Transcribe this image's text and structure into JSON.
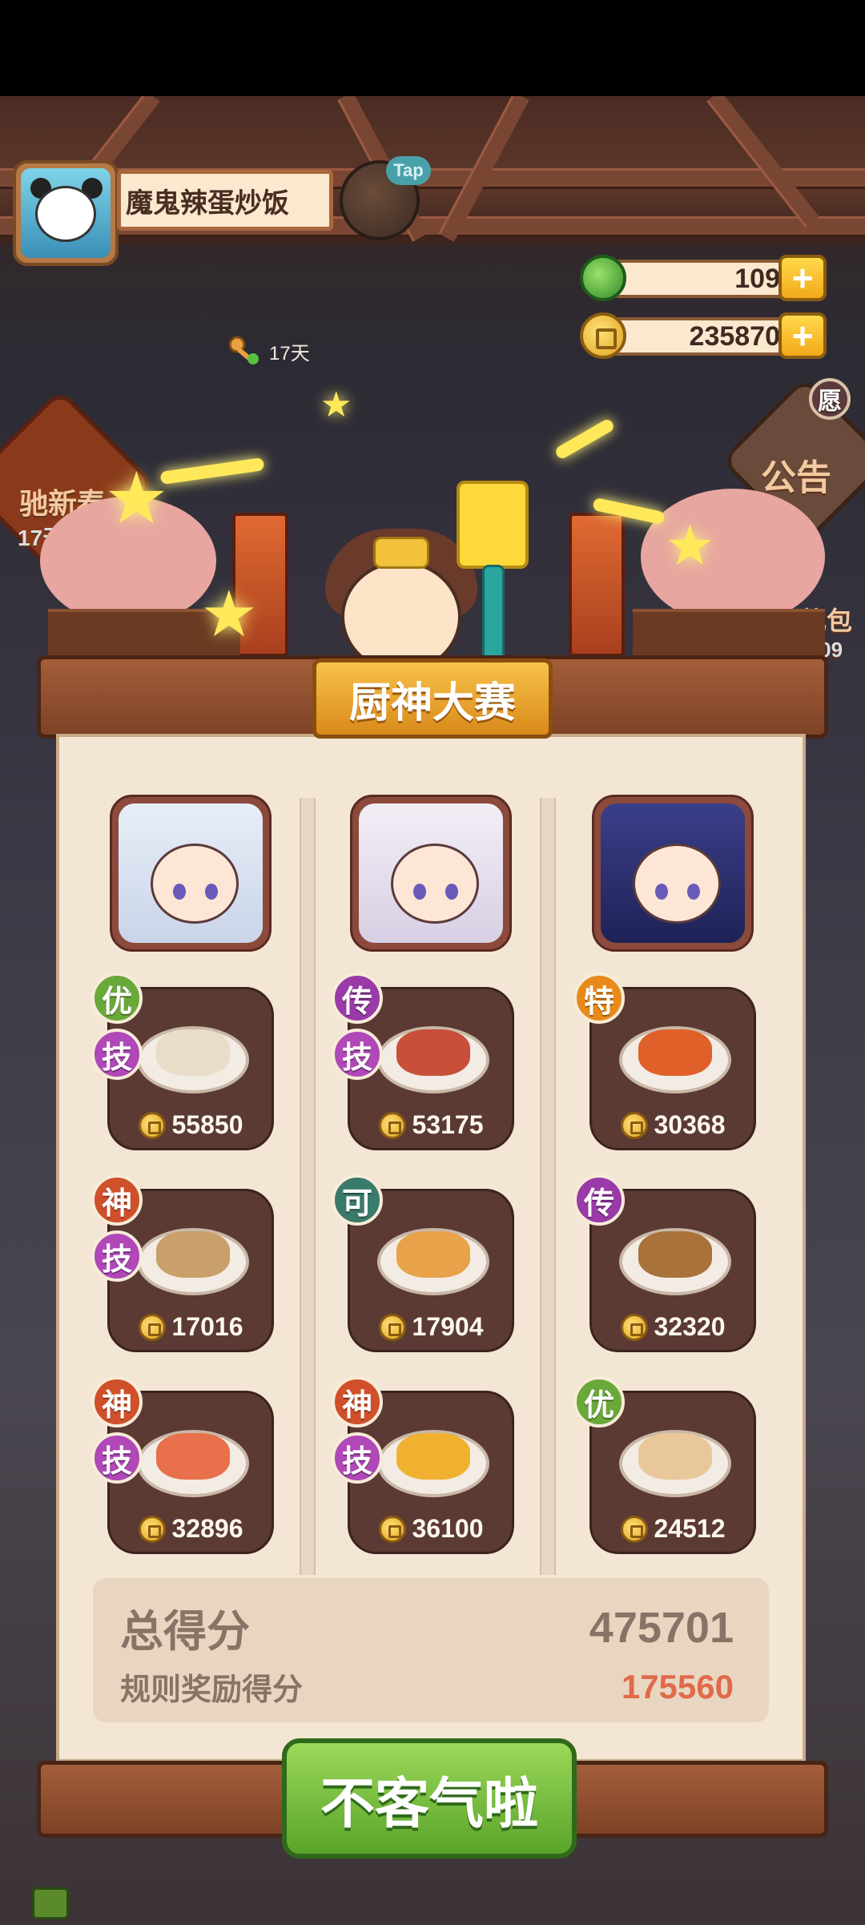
{
  "player": {
    "name": "魔鬼辣蛋炒饭",
    "days": "17天",
    "tap_label": "Tap"
  },
  "currency": {
    "jade": "109",
    "coins": "235870",
    "plus": "+"
  },
  "background_text": {
    "left_event": "驰新春",
    "left_timer": "17天",
    "notice": "公告",
    "notice_tag": "愿",
    "gift": "礼包",
    "gift_timer": "0:09"
  },
  "title": "厨神大赛",
  "chefs": [
    {
      "name": "chef-silver-hair",
      "colors": [
        "#e8eef8",
        "#c9d4e8"
      ]
    },
    {
      "name": "chef-white-hair",
      "colors": [
        "#f3eef6",
        "#d8cfe4"
      ]
    },
    {
      "name": "chef-dark-hair",
      "colors": [
        "#3a3f8a",
        "#1e2256"
      ]
    }
  ],
  "dishes": [
    {
      "col": 0,
      "row": 0,
      "rank": "优",
      "rank_color": "#6aa83a",
      "skill": "技",
      "score": "55850",
      "food": "#e9dcc8"
    },
    {
      "col": 1,
      "row": 0,
      "rank": "传",
      "rank_color": "#9a3aa8",
      "skill": "技",
      "score": "53175",
      "food": "#c8503a"
    },
    {
      "col": 2,
      "row": 0,
      "rank": "特",
      "rank_color": "#e88a1a",
      "skill": null,
      "score": "30368",
      "food": "#e0602a"
    },
    {
      "col": 0,
      "row": 1,
      "rank": "神",
      "rank_color": "#d0502a",
      "skill": "技",
      "score": "17016",
      "food": "#c9a06a"
    },
    {
      "col": 1,
      "row": 1,
      "rank": "可",
      "rank_color": "#3a7a6a",
      "skill": null,
      "score": "17904",
      "food": "#e8a24a"
    },
    {
      "col": 2,
      "row": 1,
      "rank": "传",
      "rank_color": "#9a3aa8",
      "skill": null,
      "score": "32320",
      "food": "#a8723a"
    },
    {
      "col": 0,
      "row": 2,
      "rank": "神",
      "rank_color": "#d0502a",
      "skill": "技",
      "score": "32896",
      "food": "#e8704a"
    },
    {
      "col": 1,
      "row": 2,
      "rank": "神",
      "rank_color": "#d0502a",
      "skill": "技",
      "score": "36100",
      "food": "#f0b030"
    },
    {
      "col": 2,
      "row": 2,
      "rank": "优",
      "rank_color": "#6aa83a",
      "skill": null,
      "score": "24512",
      "food": "#e8c89a"
    }
  ],
  "skill_color": "#b048b8",
  "totals": {
    "total_label": "总得分",
    "total_value": "475701",
    "bonus_label": "规则奖励得分",
    "bonus_value": "175560"
  },
  "confirm_button": "不客气啦"
}
